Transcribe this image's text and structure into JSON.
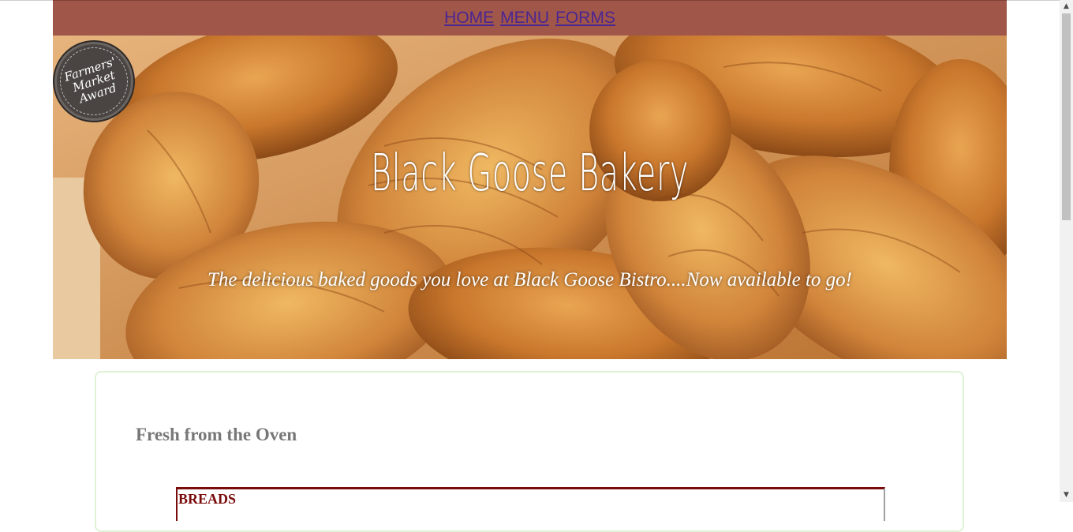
{
  "nav": {
    "items": [
      {
        "label": "HOME"
      },
      {
        "label": "MENU"
      },
      {
        "label": "FORMS"
      }
    ]
  },
  "badge": {
    "line1": "Farmers'",
    "line2": "Market",
    "line3": "Award"
  },
  "hero": {
    "brand": "Black Goose Bakery",
    "tagline": "The delicious baked goods you love at Black Goose Bistro....Now available to go!"
  },
  "section": {
    "heading": "Fresh from the Oven",
    "table_header": "BREADS"
  },
  "colors": {
    "nav_bg": "#a0574a",
    "link": "#4b2691",
    "card_border": "#dff2d6",
    "table_accent": "#7a0b0b"
  },
  "icons": [
    "scroll-up-arrow-icon",
    "scroll-down-arrow-icon"
  ]
}
